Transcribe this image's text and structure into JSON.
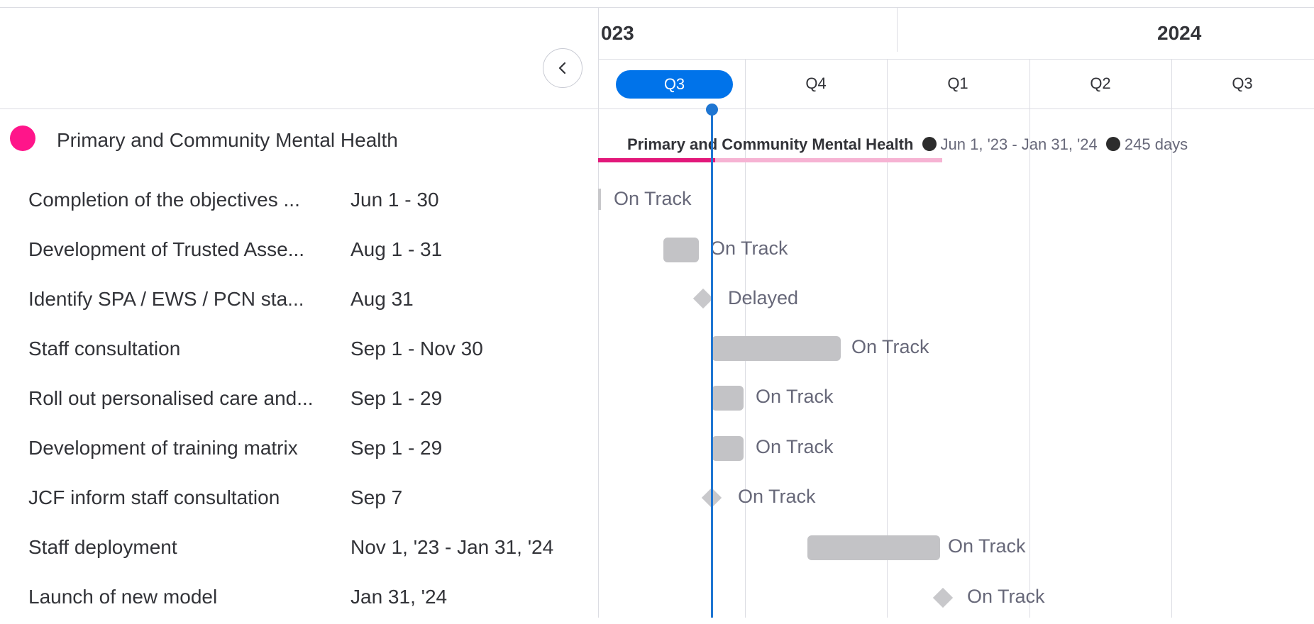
{
  "left_panel": {
    "collapse_button_label": "‹"
  },
  "group": {
    "name": "Primary and Community Mental Health",
    "color": "#ff158a",
    "summary": {
      "name": "Primary and Community Mental Health",
      "date_range": "Jun 1, '23 - Jan 31, '24",
      "duration": "245 days"
    }
  },
  "tasks": [
    {
      "name": "Completion of the objectives ...",
      "dates": "Jun 1 - 30",
      "status": "On Track"
    },
    {
      "name": "Development of Trusted Asse...",
      "dates": "Aug 1 - 31",
      "status": "On Track"
    },
    {
      "name": "Identify SPA / EWS / PCN sta...",
      "dates": "Aug 31",
      "status": "Delayed"
    },
    {
      "name": "Staff consultation",
      "dates": "Sep 1 - Nov 30",
      "status": "On Track"
    },
    {
      "name": "Roll out personalised care and...",
      "dates": "Sep 1 - 29",
      "status": "On Track"
    },
    {
      "name": "Development of training matrix",
      "dates": "Sep 1 - 29",
      "status": "On Track"
    },
    {
      "name": "JCF inform staff consultation",
      "dates": "Sep 7",
      "status": "On Track"
    },
    {
      "name": "Staff deployment",
      "dates": "Nov 1, '23 - Jan 31, '24",
      "status": "On Track"
    },
    {
      "name": "Launch of new model",
      "dates": "Jan 31, '24",
      "status": "On Track"
    }
  ],
  "timeline": {
    "years": [
      "023",
      "2024"
    ],
    "quarters": [
      "Q3",
      "Q4",
      "Q1",
      "Q2",
      "Q3"
    ],
    "current_quarter_index": 0
  },
  "colors": {
    "accent": "#0073ea",
    "group_pink": "#e2187a",
    "group_pink_light": "#f6b3d3",
    "bar_gray": "#c3c3c6"
  }
}
